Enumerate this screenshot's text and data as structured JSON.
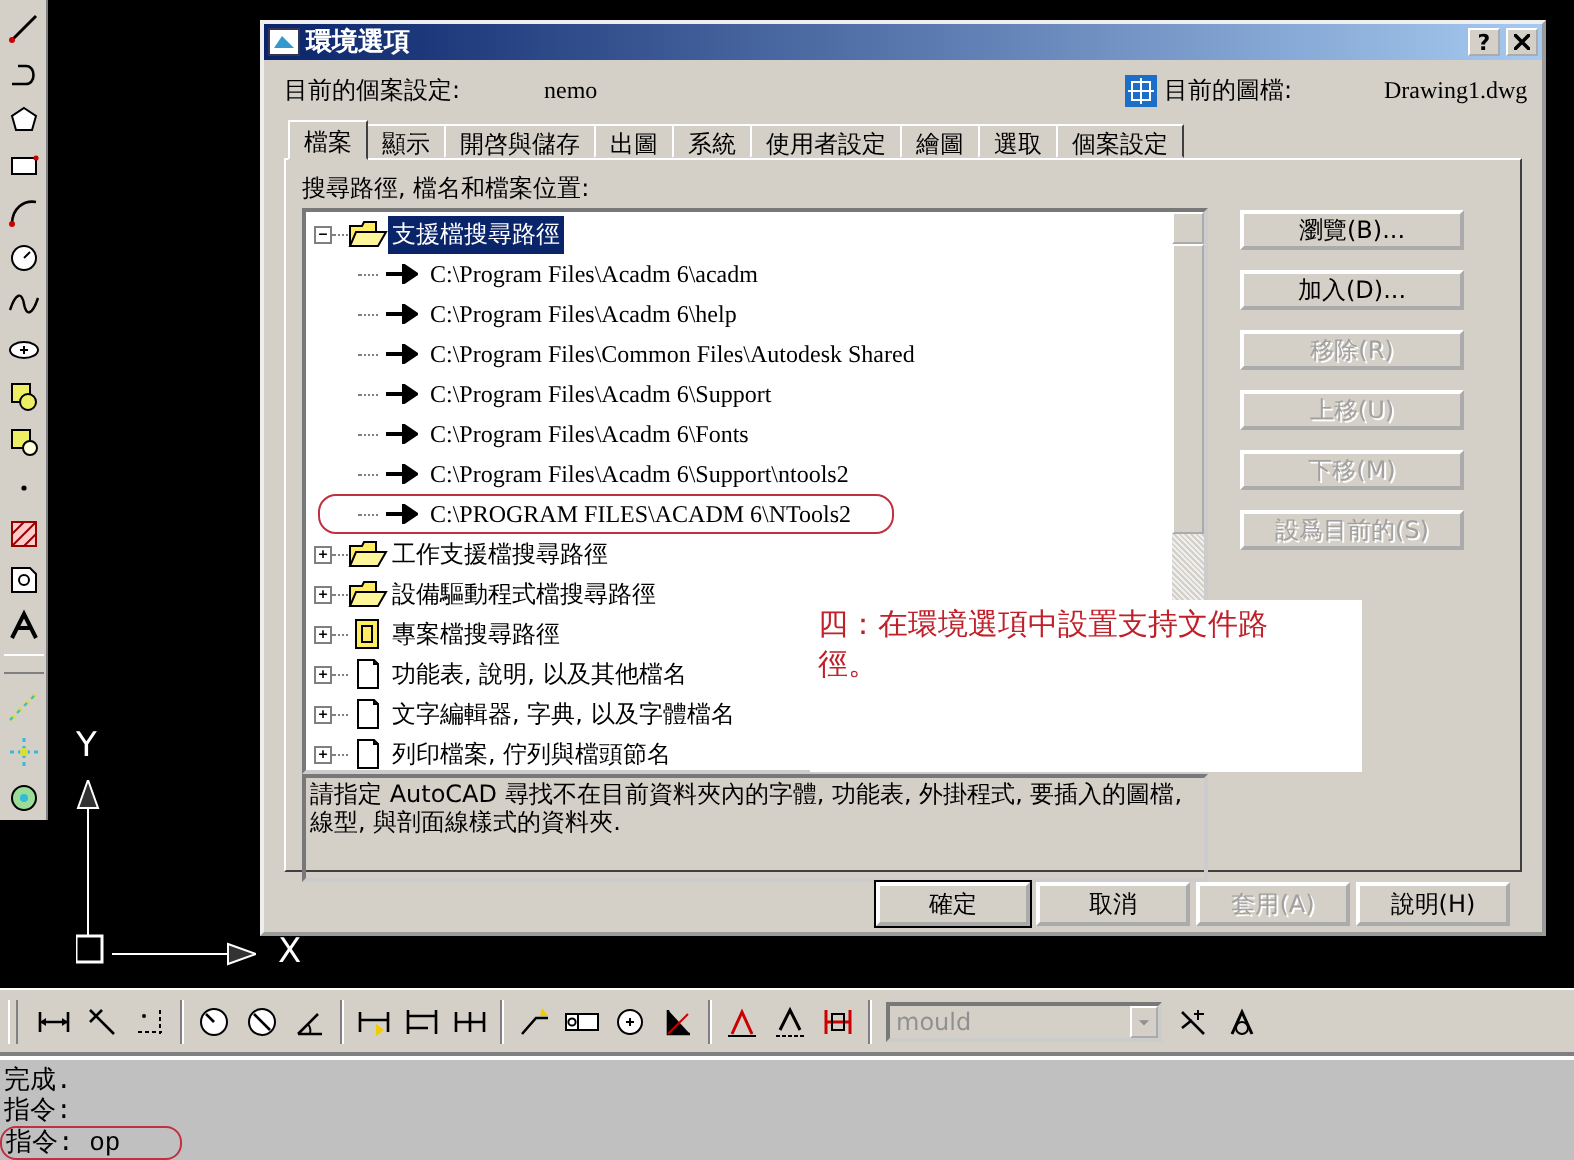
{
  "canvas": {
    "axis_labels": [
      "Y",
      "X"
    ]
  },
  "dialog": {
    "title": "環境選項",
    "help_button": "?",
    "profile_label": "目前的個案設定:",
    "profile": "nemo",
    "drawing_label": "目前的圖檔:",
    "drawing": "Drawing1.dwg",
    "tabs": [
      {
        "label": "檔案",
        "selected": true
      },
      {
        "label": "顯示",
        "selected": false
      },
      {
        "label": "開啓與儲存",
        "selected": false
      },
      {
        "label": "出圖",
        "selected": false
      },
      {
        "label": "系統",
        "selected": false
      },
      {
        "label": "使用者設定",
        "selected": false
      },
      {
        "label": "繪圖",
        "selected": false
      },
      {
        "label": "選取",
        "selected": false
      },
      {
        "label": "個案設定",
        "selected": false
      }
    ],
    "tree_label": "搜尋路徑, 檔名和檔案位置:",
    "tree": [
      {
        "label": "支援檔搜尋路徑",
        "kind": "folder",
        "expanded": true,
        "selected": true,
        "children": [
          {
            "label": "C:\\Program Files\\Acadm 6\\acadm",
            "selected": false,
            "circled": false
          },
          {
            "label": "C:\\Program Files\\Acadm 6\\help",
            "selected": false,
            "circled": false
          },
          {
            "label": "C:\\Program Files\\Common Files\\Autodesk Shared",
            "selected": false,
            "circled": false
          },
          {
            "label": "C:\\Program Files\\Acadm 6\\Support",
            "selected": false,
            "circled": false
          },
          {
            "label": "C:\\Program Files\\Acadm 6\\Fonts",
            "selected": false,
            "circled": false
          },
          {
            "label": "C:\\Program Files\\Acadm 6\\Support\\ntools2",
            "selected": false,
            "circled": false
          },
          {
            "label": "C:\\PROGRAM FILES\\ACADM 6\\NTools2",
            "selected": false,
            "circled": true
          }
        ]
      },
      {
        "label": "工作支援檔搜尋路徑",
        "kind": "folder",
        "expanded": false,
        "selected": false
      },
      {
        "label": "設備驅動程式檔搜尋路徑",
        "kind": "folder",
        "expanded": false,
        "selected": false
      },
      {
        "label": "專案檔搜尋路徑",
        "kind": "book",
        "expanded": false,
        "selected": false
      },
      {
        "label": "功能表, 說明, 以及其他檔名",
        "kind": "page",
        "expanded": false,
        "selected": false
      },
      {
        "label": "文字編輯器, 字典, 以及字體檔名",
        "kind": "page",
        "expanded": false,
        "selected": false
      },
      {
        "label": "列印檔案, 佇列與檔頭節名",
        "kind": "page",
        "expanded": false,
        "selected": false
      }
    ],
    "description": "請指定 AutoCAD 尋找不在目前資料夾內的字體, 功能表, 外掛程式, 要插入的圖檔, 線型, 與剖面線樣式的資料夾.",
    "side_buttons": [
      {
        "label": "瀏覽(B)...",
        "disabled": false
      },
      {
        "label": "加入(D)...",
        "disabled": false
      },
      {
        "label": "移除(R)",
        "disabled": true
      },
      {
        "label": "上移(U)",
        "disabled": true
      },
      {
        "label": "下移(M)",
        "disabled": true
      },
      {
        "label": "設爲目前的(S)",
        "disabled": true
      }
    ],
    "footer_buttons": [
      {
        "label": "確定",
        "disabled": false,
        "default": true
      },
      {
        "label": "取消",
        "disabled": false,
        "default": false
      },
      {
        "label": "套用(A)",
        "disabled": true,
        "default": false
      },
      {
        "label": "說明(H)",
        "disabled": false,
        "default": false
      }
    ]
  },
  "annotation": {
    "text": "四：在環境選項中設置支持文件路徑。"
  },
  "dim_toolbar": {
    "style_dropdown": {
      "value": "mould",
      "disabled": true
    }
  },
  "command": {
    "lines": [
      {
        "text": "完成.",
        "circled": false
      },
      {
        "text": "指令:",
        "circled": false
      },
      {
        "text": "指令: op",
        "circled": true
      }
    ]
  }
}
